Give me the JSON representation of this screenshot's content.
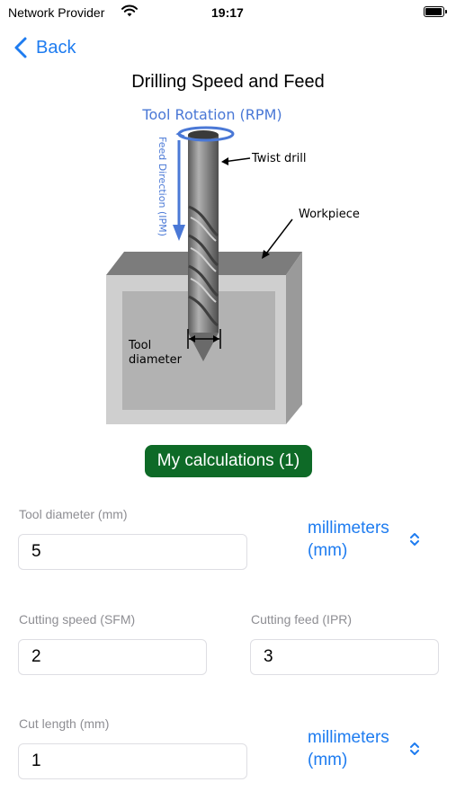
{
  "status_bar": {
    "carrier": "Network Provider",
    "time": "19:17"
  },
  "nav": {
    "back_label": "Back"
  },
  "page": {
    "title": "Drilling Speed and Feed"
  },
  "diagram": {
    "rotation_label": "Tool Rotation (RPM)",
    "feed_label": "Feed Direction (IPM)",
    "twist_drill_label": "Twist drill",
    "workpiece_label": "Workpiece",
    "tool_label_line1": "Tool",
    "tool_label_line2": "diameter"
  },
  "calculations_button": "My calculations (1)",
  "form": {
    "tool_diameter": {
      "label": "Tool diameter (mm)",
      "value": "5",
      "unit_line1": "millimeters",
      "unit_line2": "(mm)"
    },
    "cutting_speed": {
      "label": "Cutting speed (SFM)",
      "value": "2"
    },
    "cutting_feed": {
      "label": "Cutting feed (IPR)",
      "value": "3"
    },
    "cut_length": {
      "label": "Cut length (mm)",
      "value": "1",
      "unit_line1": "millimeters",
      "unit_line2": "(mm)"
    }
  },
  "colors": {
    "accent": "#1e7cf0",
    "button_green": "#0e6a27",
    "diagram_blue": "#4a78d6"
  }
}
